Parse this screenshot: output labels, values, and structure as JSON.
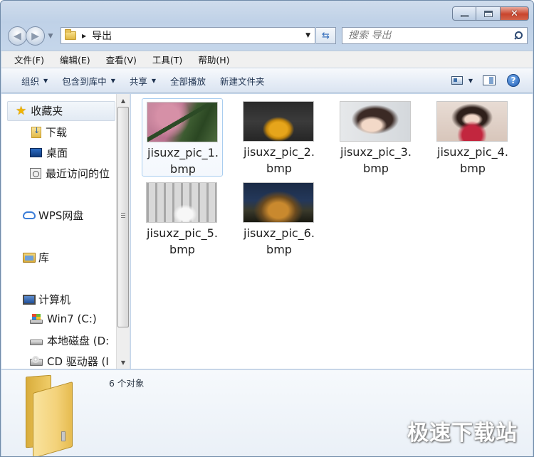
{
  "window": {
    "controls": {
      "minimize_icon": "minimize-icon",
      "maximize_icon": "maximize-icon",
      "close_icon": "close-icon"
    }
  },
  "navigation": {
    "back_icon": "back-arrow-icon",
    "forward_icon": "forward-arrow-icon",
    "address": {
      "folder_icon": "folder-icon",
      "path": "导出"
    },
    "refresh_icon": "refresh-icon"
  },
  "search": {
    "placeholder": "搜索 导出",
    "icon": "search-icon"
  },
  "menubar": {
    "items": [
      {
        "label": "文件(F)"
      },
      {
        "label": "编辑(E)"
      },
      {
        "label": "查看(V)"
      },
      {
        "label": "工具(T)"
      },
      {
        "label": "帮助(H)"
      }
    ]
  },
  "toolbar": {
    "organize": "组织",
    "include_in_library": "包含到库中",
    "share": "共享",
    "play_all": "全部播放",
    "new_folder": "新建文件夹",
    "help_icon": "help-icon"
  },
  "sidebar": {
    "favorites": {
      "label": "收藏夹",
      "icon": "star-icon"
    },
    "items": [
      {
        "label": "下载",
        "icon": "downloads-folder-icon"
      },
      {
        "label": "桌面",
        "icon": "desktop-icon"
      },
      {
        "label": "最近访问的位",
        "icon": "recent-places-icon"
      }
    ],
    "wps": {
      "label": "WPS网盘",
      "icon": "cloud-icon"
    },
    "library": {
      "label": "库",
      "icon": "library-icon"
    },
    "computer": {
      "label": "计算机",
      "icon": "computer-icon"
    },
    "drives": [
      {
        "label": "Win7 (C:)",
        "icon": "windows-drive-icon"
      },
      {
        "label": "本地磁盘 (D:",
        "icon": "hard-drive-icon"
      },
      {
        "label": "CD 驱动器 (I",
        "icon": "cd-drive-icon"
      }
    ]
  },
  "files": [
    {
      "line1": "jisuxz_pic_1.",
      "line2": "bmp",
      "selected": true
    },
    {
      "line1": "jisuxz_pic_2.",
      "line2": "bmp",
      "selected": false
    },
    {
      "line1": "jisuxz_pic_3.",
      "line2": "bmp",
      "selected": false
    },
    {
      "line1": "jisuxz_pic_4.",
      "line2": "bmp",
      "selected": false
    },
    {
      "line1": "jisuxz_pic_5.",
      "line2": "bmp",
      "selected": false
    },
    {
      "line1": "jisuxz_pic_6.",
      "line2": "bmp",
      "selected": false
    }
  ],
  "details": {
    "count": "6 个对象",
    "icon": "folder-large-icon"
  },
  "watermark": "极速下载站"
}
